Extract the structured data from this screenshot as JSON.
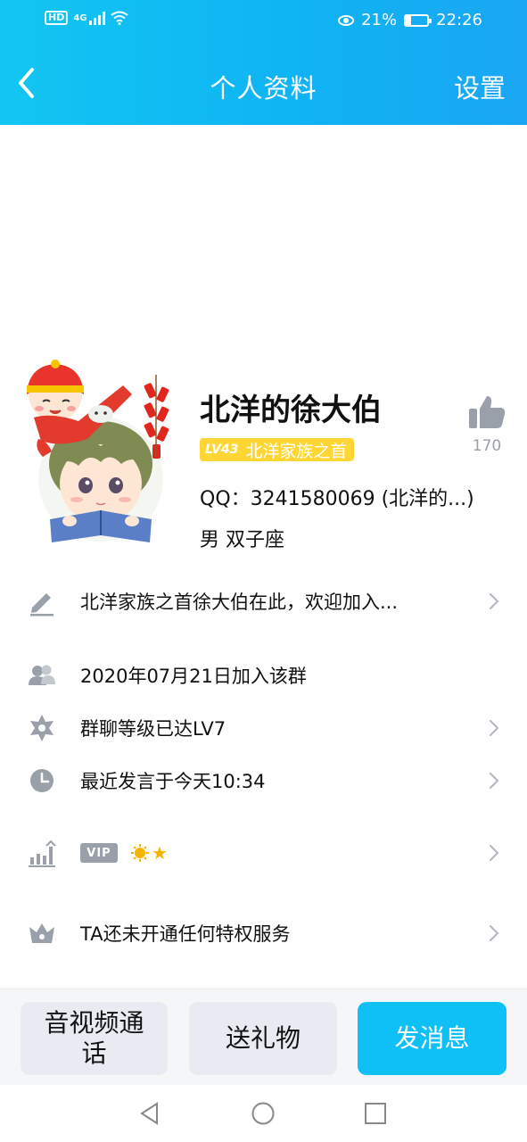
{
  "status_bar": {
    "network": "4G",
    "battery": "21%",
    "time": "22:26"
  },
  "nav": {
    "title": "个人资料",
    "settings": "设置"
  },
  "profile": {
    "name": "北洋的徐大伯",
    "level": "LV43",
    "group_title": "北洋家族之首",
    "qq": "QQ：3241580069 (北洋的...)",
    "gender_sign": "男 双子座",
    "likes": "170"
  },
  "rows": {
    "signature": "北洋家族之首徐大伯在此，欢迎加入...",
    "joined": "2020年07月21日加入该群",
    "group_level": "群聊等级已达LV7",
    "last_speak": "最近发言于今天10:34",
    "vip_badge": "VIP",
    "privilege": "TA还未开通任何特权服务"
  },
  "buttons": {
    "call": "音视频通话",
    "gift": "送礼物",
    "message": "发消息"
  },
  "colors": {
    "header": "#12c6f2",
    "accent": "#0fc0f7",
    "icon_gray": "#9aa0aa",
    "level_tag": "#ffd633"
  }
}
